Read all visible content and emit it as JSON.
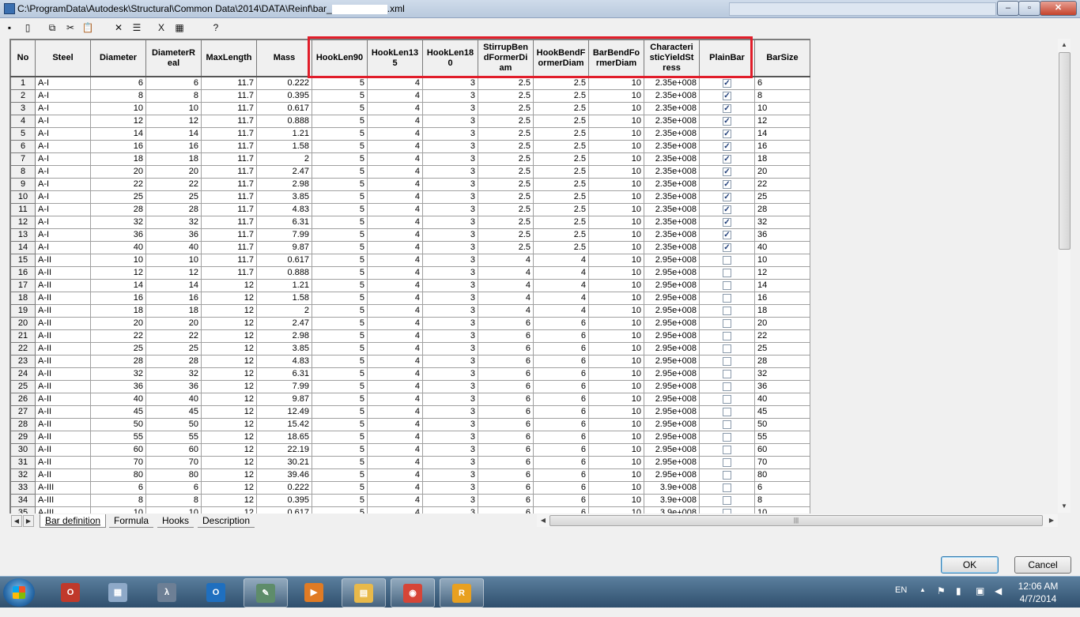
{
  "window": {
    "title_prefix": "C:\\ProgramData\\Autodesk\\Structural\\Common Data\\2014\\DATA\\Reinf\\bar_",
    "title_suffix": ".xml",
    "minimize": "–",
    "maximize": "▫",
    "close": "✕"
  },
  "toolbar": [
    {
      "name": "save-icon",
      "glyph": "▪"
    },
    {
      "name": "new-icon",
      "glyph": "▯"
    },
    {
      "name": "copy-icon",
      "glyph": "⧉"
    },
    {
      "name": "cut-icon",
      "glyph": "✂"
    },
    {
      "name": "paste-icon",
      "glyph": "📋"
    },
    {
      "name": "delete-icon",
      "glyph": "✕"
    },
    {
      "name": "insert-row-icon",
      "glyph": "☰"
    },
    {
      "name": "excel-export-icon",
      "glyph": "X"
    },
    {
      "name": "table-icon",
      "glyph": "▦"
    },
    {
      "name": "help-icon",
      "glyph": "?"
    }
  ],
  "grid": {
    "columns": [
      "No",
      "Steel",
      "Diameter",
      "DiameterR eal",
      "MaxLength",
      "Mass",
      "HookLen90",
      "HookLen13 5",
      "HookLen18 0",
      "StirrupBen dFormerDi am",
      "HookBendF ormerDiam",
      "BarBendFo rmerDiam",
      "Characteri sticYieldSt ress",
      "PlainBar",
      "BarSize"
    ],
    "rows": [
      [
        "1",
        "A-I",
        "6",
        "6",
        "11.7",
        "0.222",
        "5",
        "4",
        "3",
        "2.5",
        "2.5",
        "10",
        "2.35e+008",
        true,
        "6"
      ],
      [
        "2",
        "A-I",
        "8",
        "8",
        "11.7",
        "0.395",
        "5",
        "4",
        "3",
        "2.5",
        "2.5",
        "10",
        "2.35e+008",
        true,
        "8"
      ],
      [
        "3",
        "A-I",
        "10",
        "10",
        "11.7",
        "0.617",
        "5",
        "4",
        "3",
        "2.5",
        "2.5",
        "10",
        "2.35e+008",
        true,
        "10"
      ],
      [
        "4",
        "A-I",
        "12",
        "12",
        "11.7",
        "0.888",
        "5",
        "4",
        "3",
        "2.5",
        "2.5",
        "10",
        "2.35e+008",
        true,
        "12"
      ],
      [
        "5",
        "A-I",
        "14",
        "14",
        "11.7",
        "1.21",
        "5",
        "4",
        "3",
        "2.5",
        "2.5",
        "10",
        "2.35e+008",
        true,
        "14"
      ],
      [
        "6",
        "A-I",
        "16",
        "16",
        "11.7",
        "1.58",
        "5",
        "4",
        "3",
        "2.5",
        "2.5",
        "10",
        "2.35e+008",
        true,
        "16"
      ],
      [
        "7",
        "A-I",
        "18",
        "18",
        "11.7",
        "2",
        "5",
        "4",
        "3",
        "2.5",
        "2.5",
        "10",
        "2.35e+008",
        true,
        "18"
      ],
      [
        "8",
        "A-I",
        "20",
        "20",
        "11.7",
        "2.47",
        "5",
        "4",
        "3",
        "2.5",
        "2.5",
        "10",
        "2.35e+008",
        true,
        "20"
      ],
      [
        "9",
        "A-I",
        "22",
        "22",
        "11.7",
        "2.98",
        "5",
        "4",
        "3",
        "2.5",
        "2.5",
        "10",
        "2.35e+008",
        true,
        "22"
      ],
      [
        "10",
        "A-I",
        "25",
        "25",
        "11.7",
        "3.85",
        "5",
        "4",
        "3",
        "2.5",
        "2.5",
        "10",
        "2.35e+008",
        true,
        "25"
      ],
      [
        "11",
        "A-I",
        "28",
        "28",
        "11.7",
        "4.83",
        "5",
        "4",
        "3",
        "2.5",
        "2.5",
        "10",
        "2.35e+008",
        true,
        "28"
      ],
      [
        "12",
        "A-I",
        "32",
        "32",
        "11.7",
        "6.31",
        "5",
        "4",
        "3",
        "2.5",
        "2.5",
        "10",
        "2.35e+008",
        true,
        "32"
      ],
      [
        "13",
        "A-I",
        "36",
        "36",
        "11.7",
        "7.99",
        "5",
        "4",
        "3",
        "2.5",
        "2.5",
        "10",
        "2.35e+008",
        true,
        "36"
      ],
      [
        "14",
        "A-I",
        "40",
        "40",
        "11.7",
        "9.87",
        "5",
        "4",
        "3",
        "2.5",
        "2.5",
        "10",
        "2.35e+008",
        true,
        "40"
      ],
      [
        "15",
        "A-II",
        "10",
        "10",
        "11.7",
        "0.617",
        "5",
        "4",
        "3",
        "4",
        "4",
        "10",
        "2.95e+008",
        false,
        "10"
      ],
      [
        "16",
        "A-II",
        "12",
        "12",
        "11.7",
        "0.888",
        "5",
        "4",
        "3",
        "4",
        "4",
        "10",
        "2.95e+008",
        false,
        "12"
      ],
      [
        "17",
        "A-II",
        "14",
        "14",
        "12",
        "1.21",
        "5",
        "4",
        "3",
        "4",
        "4",
        "10",
        "2.95e+008",
        false,
        "14"
      ],
      [
        "18",
        "A-II",
        "16",
        "16",
        "12",
        "1.58",
        "5",
        "4",
        "3",
        "4",
        "4",
        "10",
        "2.95e+008",
        false,
        "16"
      ],
      [
        "19",
        "A-II",
        "18",
        "18",
        "12",
        "2",
        "5",
        "4",
        "3",
        "4",
        "4",
        "10",
        "2.95e+008",
        false,
        "18"
      ],
      [
        "20",
        "A-II",
        "20",
        "20",
        "12",
        "2.47",
        "5",
        "4",
        "3",
        "6",
        "6",
        "10",
        "2.95e+008",
        false,
        "20"
      ],
      [
        "21",
        "A-II",
        "22",
        "22",
        "12",
        "2.98",
        "5",
        "4",
        "3",
        "6",
        "6",
        "10",
        "2.95e+008",
        false,
        "22"
      ],
      [
        "22",
        "A-II",
        "25",
        "25",
        "12",
        "3.85",
        "5",
        "4",
        "3",
        "6",
        "6",
        "10",
        "2.95e+008",
        false,
        "25"
      ],
      [
        "23",
        "A-II",
        "28",
        "28",
        "12",
        "4.83",
        "5",
        "4",
        "3",
        "6",
        "6",
        "10",
        "2.95e+008",
        false,
        "28"
      ],
      [
        "24",
        "A-II",
        "32",
        "32",
        "12",
        "6.31",
        "5",
        "4",
        "3",
        "6",
        "6",
        "10",
        "2.95e+008",
        false,
        "32"
      ],
      [
        "25",
        "A-II",
        "36",
        "36",
        "12",
        "7.99",
        "5",
        "4",
        "3",
        "6",
        "6",
        "10",
        "2.95e+008",
        false,
        "36"
      ],
      [
        "26",
        "A-II",
        "40",
        "40",
        "12",
        "9.87",
        "5",
        "4",
        "3",
        "6",
        "6",
        "10",
        "2.95e+008",
        false,
        "40"
      ],
      [
        "27",
        "A-II",
        "45",
        "45",
        "12",
        "12.49",
        "5",
        "4",
        "3",
        "6",
        "6",
        "10",
        "2.95e+008",
        false,
        "45"
      ],
      [
        "28",
        "A-II",
        "50",
        "50",
        "12",
        "15.42",
        "5",
        "4",
        "3",
        "6",
        "6",
        "10",
        "2.95e+008",
        false,
        "50"
      ],
      [
        "29",
        "A-II",
        "55",
        "55",
        "12",
        "18.65",
        "5",
        "4",
        "3",
        "6",
        "6",
        "10",
        "2.95e+008",
        false,
        "55"
      ],
      [
        "30",
        "A-II",
        "60",
        "60",
        "12",
        "22.19",
        "5",
        "4",
        "3",
        "6",
        "6",
        "10",
        "2.95e+008",
        false,
        "60"
      ],
      [
        "31",
        "A-II",
        "70",
        "70",
        "12",
        "30.21",
        "5",
        "4",
        "3",
        "6",
        "6",
        "10",
        "2.95e+008",
        false,
        "70"
      ],
      [
        "32",
        "A-II",
        "80",
        "80",
        "12",
        "39.46",
        "5",
        "4",
        "3",
        "6",
        "6",
        "10",
        "2.95e+008",
        false,
        "80"
      ],
      [
        "33",
        "A-III",
        "6",
        "6",
        "12",
        "0.222",
        "5",
        "4",
        "3",
        "6",
        "6",
        "10",
        "3.9e+008",
        false,
        "6"
      ],
      [
        "34",
        "A-III",
        "8",
        "8",
        "12",
        "0.395",
        "5",
        "4",
        "3",
        "6",
        "6",
        "10",
        "3.9e+008",
        false,
        "8"
      ],
      [
        "35",
        "A-III",
        "10",
        "10",
        "12",
        "0.617",
        "5",
        "4",
        "3",
        "6",
        "6",
        "10",
        "3.9e+008",
        false,
        "10"
      ]
    ]
  },
  "sheet_tabs": [
    "Bar definition",
    "Formula",
    "Hooks",
    "Description"
  ],
  "dialog": {
    "ok": "OK",
    "cancel": "Cancel"
  },
  "taskbar": {
    "apps": [
      {
        "name": "office-app-icon",
        "glyph": "O",
        "color": "#c0392b"
      },
      {
        "name": "calculator-icon",
        "glyph": "▦",
        "color": "#8ea9c8"
      },
      {
        "name": "math-app-icon",
        "glyph": "λ",
        "color": "#6d7f95"
      },
      {
        "name": "outlook-icon",
        "glyph": "O",
        "color": "#1f6fbf"
      },
      {
        "name": "notepad-icon",
        "glyph": "✎",
        "color": "#5e8c6a",
        "open": true
      },
      {
        "name": "media-player-icon",
        "glyph": "▶",
        "color": "#e07b24"
      },
      {
        "name": "explorer-icon",
        "glyph": "▤",
        "color": "#e8b94a",
        "open": true
      },
      {
        "name": "chrome-icon",
        "glyph": "◉",
        "color": "#d64537",
        "open": true
      },
      {
        "name": "autodesk-robot-icon",
        "glyph": "R",
        "color": "#e8a020",
        "open": true
      }
    ],
    "language": "EN",
    "time": "12:06 AM",
    "date": "4/7/2014"
  }
}
